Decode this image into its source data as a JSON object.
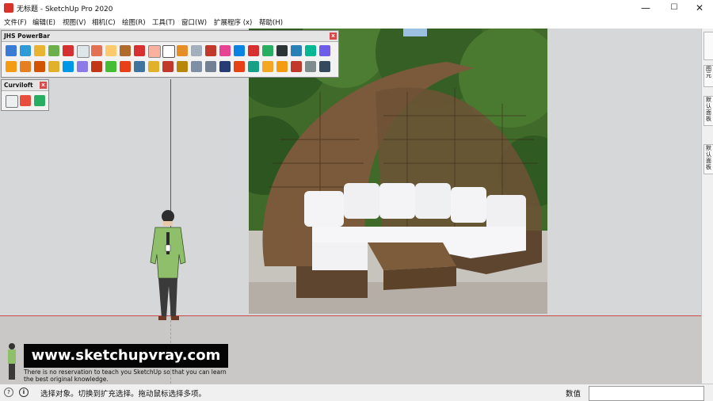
{
  "window": {
    "title": "无标题 - SketchUp Pro 2020",
    "min_glyph": "—",
    "max_glyph": "☐",
    "close_glyph": "✕"
  },
  "menu": [
    "文件(F)",
    "编辑(E)",
    "视图(V)",
    "相机(C)",
    "绘图(R)",
    "工具(T)",
    "窗口(W)",
    "扩展程序 (x)",
    "帮助(H)"
  ],
  "panels": {
    "jhs": {
      "title": "JHS PowerBar",
      "close": "x"
    },
    "curviloft": {
      "title": "Curviloft",
      "close": "x"
    }
  },
  "side_tabs": [
    "图元",
    "默认面板",
    "默认面板"
  ],
  "overlay": {
    "banner": "www.sketchupvray.com",
    "subtitle": "There is no reservation to teach you SketchUp so that you can learn the best original knowledge."
  },
  "status": {
    "message": "选择对象。切换到扩充选择。拖动鼠标选择多项。",
    "measurement_label": "数值",
    "measurement_value": ""
  },
  "colors": {
    "x_axis": "#c84a4a",
    "z_axis": "#3a52c7",
    "sky": "#d6d7d9"
  }
}
